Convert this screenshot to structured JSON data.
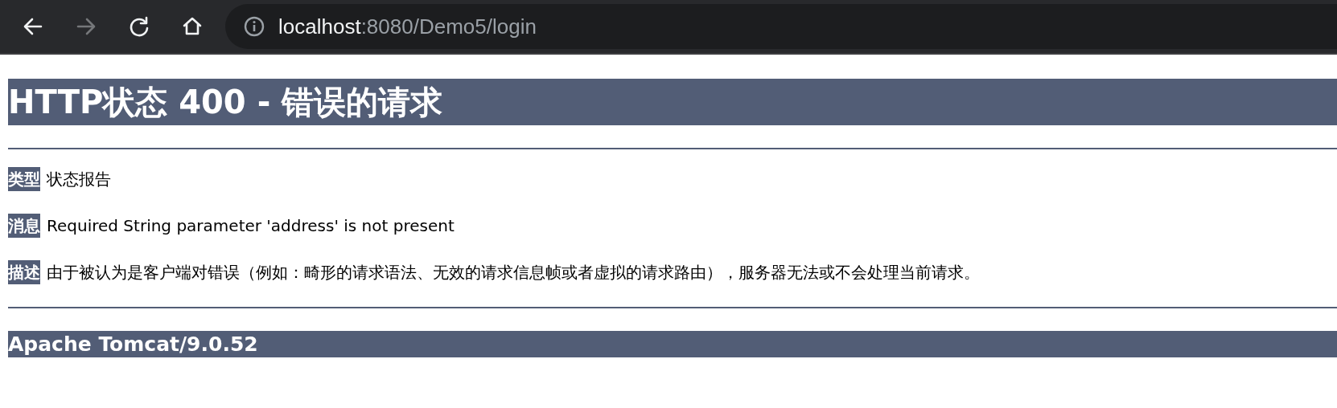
{
  "toolbar": {
    "buttons": [
      {
        "kind": "back",
        "disabled": false
      },
      {
        "kind": "forward",
        "disabled": true
      },
      {
        "kind": "reload",
        "disabled": false
      },
      {
        "kind": "home",
        "disabled": false
      }
    ],
    "address": {
      "host": "localhost",
      "rest": ":8080/Demo5/login"
    }
  },
  "page": {
    "title": "HTTP状态 400 - 错误的请求",
    "fields": [
      {
        "label": "类型",
        "text": "状态报告"
      },
      {
        "label": "消息",
        "text": "Required String parameter 'address' is not present"
      },
      {
        "label": "描述",
        "text": "由于被认为是客户端对错误（例如：畸形的请求语法、无效的请求信息帧或者虚拟的请求路由），服务器无法或不会处理当前请求。"
      }
    ],
    "footer": "Apache Tomcat/9.0.52"
  }
}
